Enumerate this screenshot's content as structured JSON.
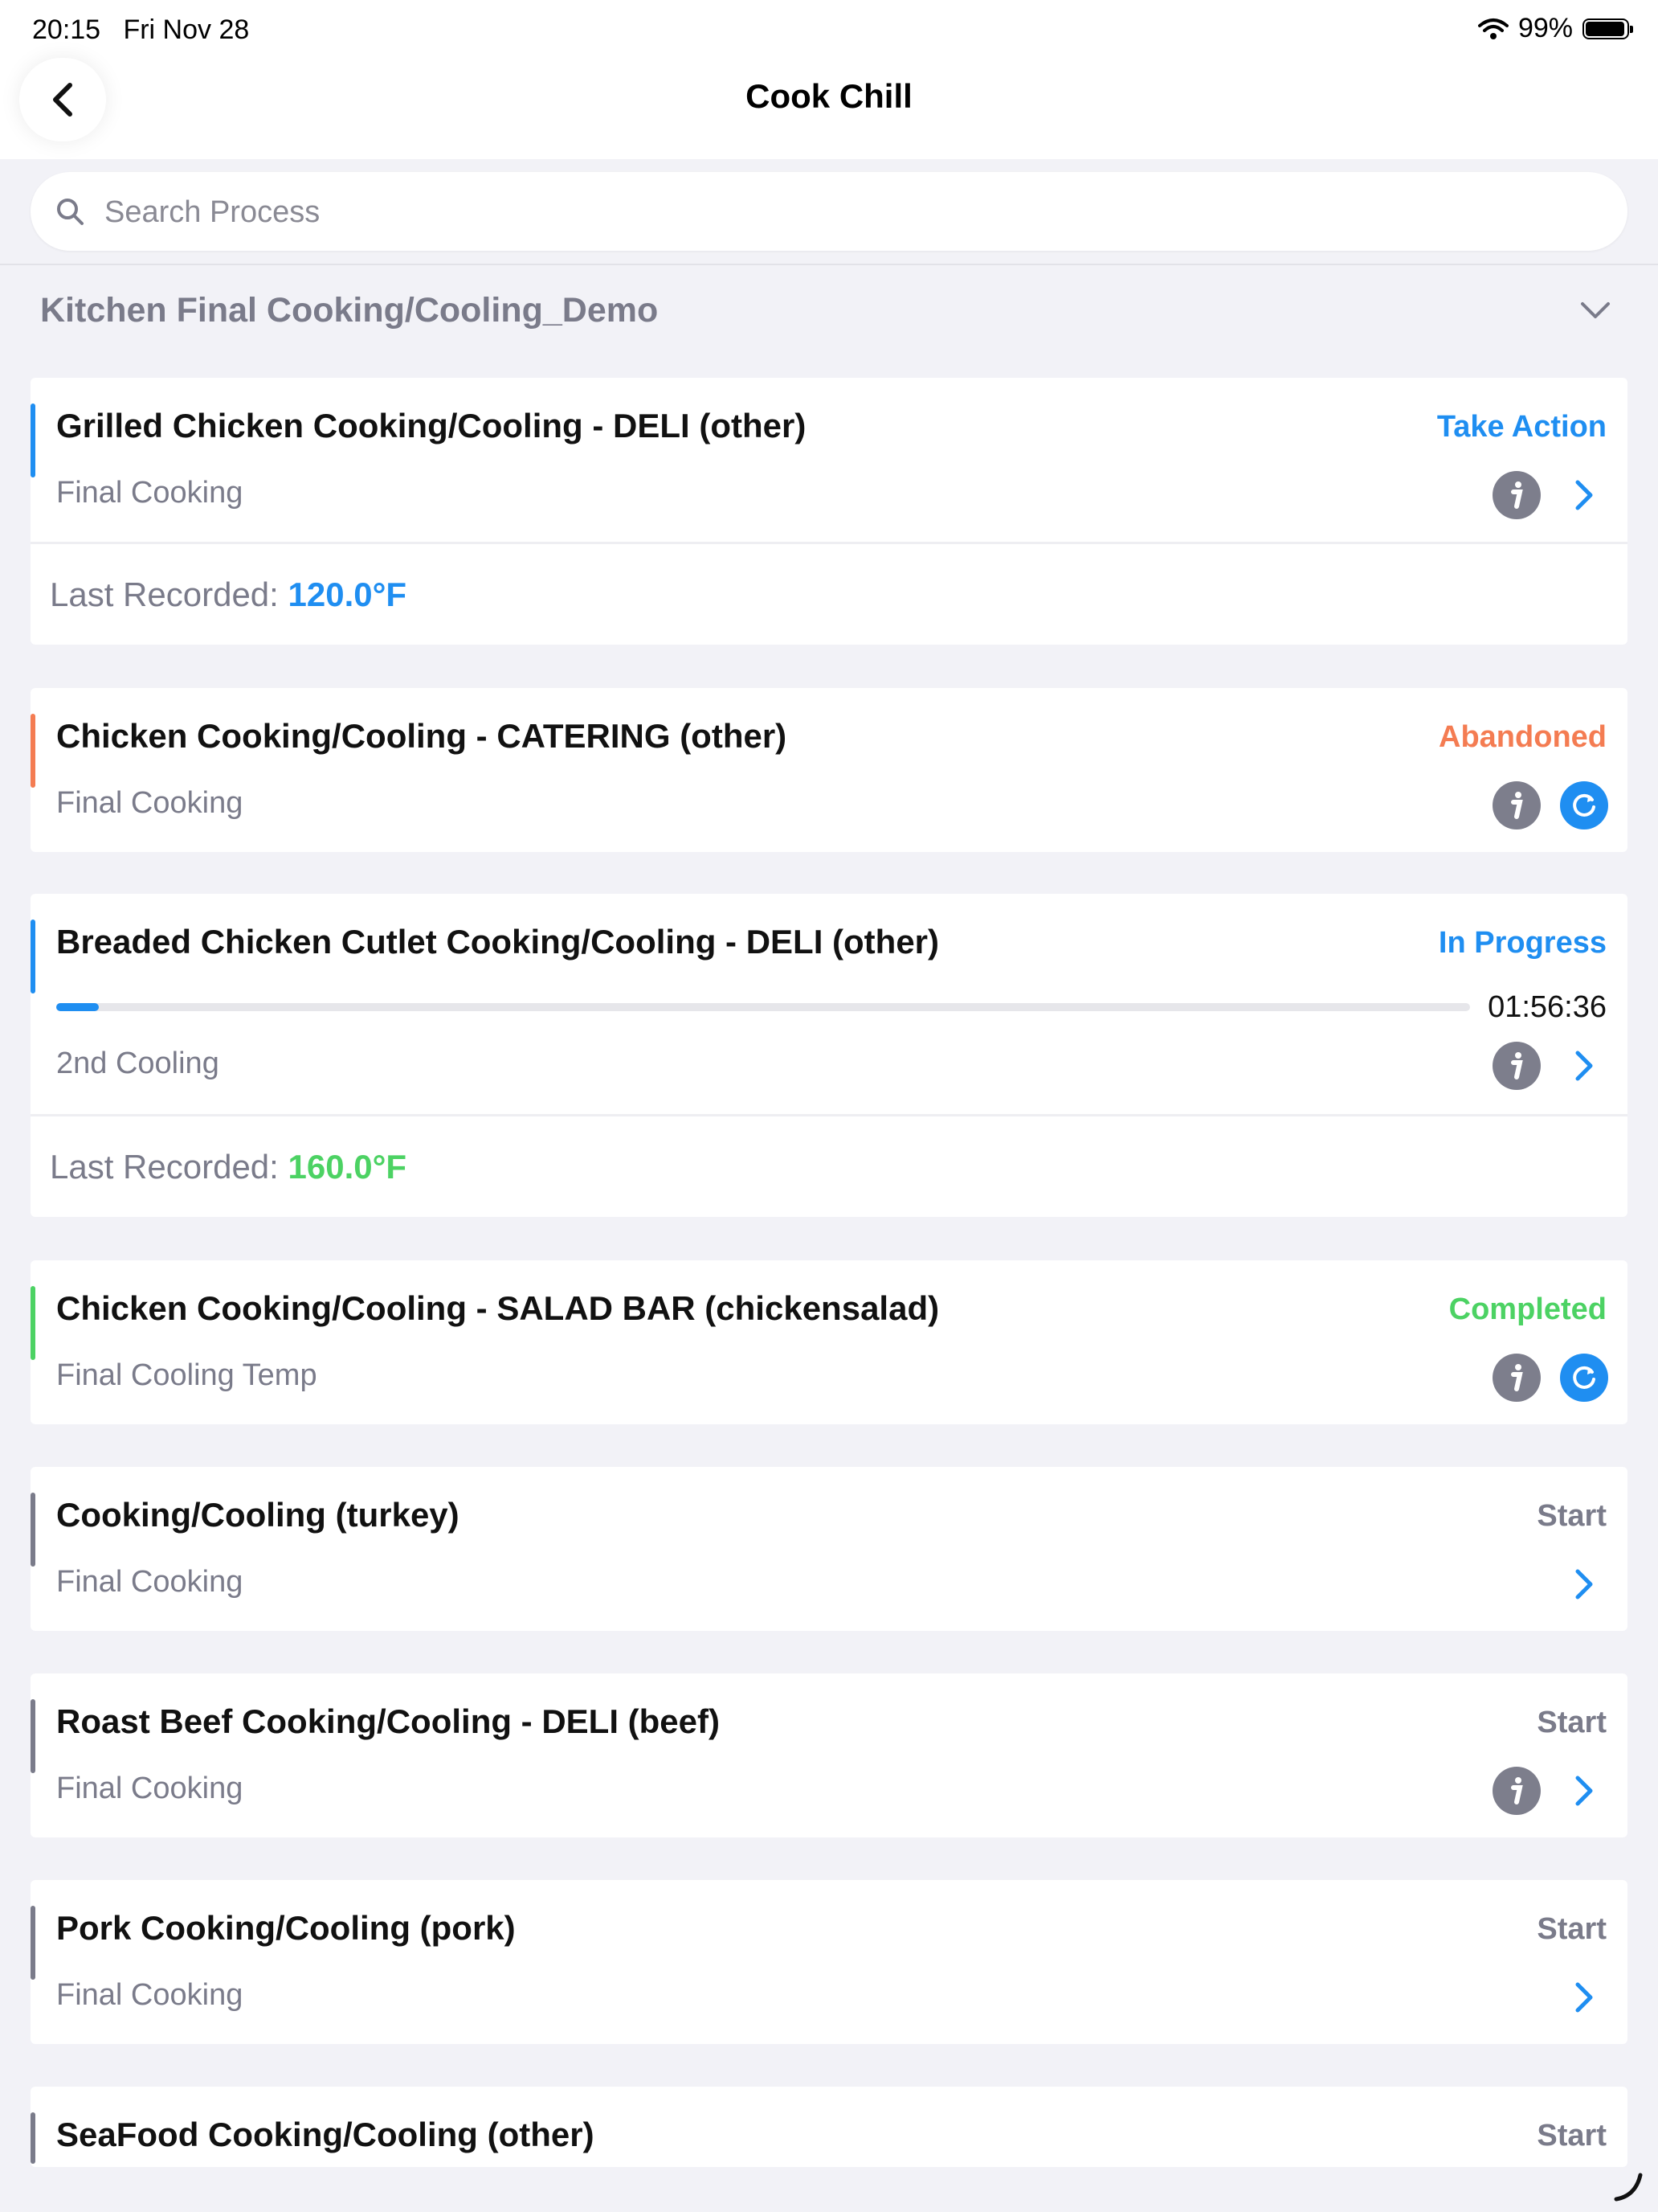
{
  "status_bar": {
    "time": "20:15",
    "date": "Fri Nov 28",
    "battery": "99%"
  },
  "nav": {
    "title": "Cook Chill"
  },
  "search": {
    "placeholder": "Search Process"
  },
  "group": {
    "title": "Kitchen Final Cooking/Cooling_Demo"
  },
  "colors": {
    "blue": "#1f8ef1",
    "orange": "#f47c52",
    "green": "#4cd263",
    "gray": "#7a7b8a"
  },
  "processes": [
    {
      "title": "Grilled Chicken Cooking/Cooling - DELI (other)",
      "status": "Take Action",
      "stage": "Final Cooking",
      "last_recorded_label": "Last Recorded:",
      "last_recorded_value": "120.0°F"
    },
    {
      "title": "Chicken Cooking/Cooling - CATERING (other)",
      "status": "Abandoned",
      "stage": "Final Cooking"
    },
    {
      "title": "Breaded Chicken Cutlet Cooking/Cooling - DELI (other)",
      "status": "In Progress",
      "progress": 0.03,
      "timer": "01:56:36",
      "stage": "2nd Cooling",
      "last_recorded_label": "Last Recorded:",
      "last_recorded_value": "160.0°F"
    },
    {
      "title": "Chicken Cooking/Cooling - SALAD BAR (chickensalad)",
      "status": "Completed",
      "stage": "Final Cooling Temp"
    },
    {
      "title": "Cooking/Cooling (turkey)",
      "status": "Start",
      "stage": "Final Cooking"
    },
    {
      "title": "Roast Beef Cooking/Cooling - DELI (beef)",
      "status": "Start",
      "stage": "Final Cooking"
    },
    {
      "title": "Pork Cooking/Cooling (pork)",
      "status": "Start",
      "stage": "Final Cooking"
    },
    {
      "title": "SeaFood Cooking/Cooling (other)",
      "status": "Start"
    }
  ]
}
